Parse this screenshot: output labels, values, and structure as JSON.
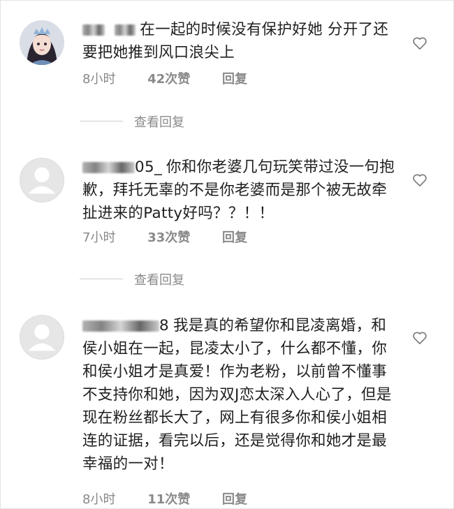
{
  "comments": [
    {
      "username_visible": "",
      "text": "在一起的时候没有保护好她 分开了还要把她推到风口浪尖上",
      "time": "8小时",
      "likes": "42次赞",
      "reply": "回复"
    },
    {
      "username_visible": "05_",
      "text": "你和你老婆几句玩笑带过没一句抱歉，拜托无辜的不是你老婆而是那个被无故牵扯进来的Patty好吗？？！！",
      "time": "7小时",
      "likes": "33次赞",
      "reply": "回复"
    },
    {
      "username_visible": "8",
      "text": "我是真的希望你和昆凌离婚，和侯小姐在一起，昆凌太小了，什么都不懂，你和侯小姐才是真爱！作为老粉，以前曾不懂事不支持你和她，因为双J恋太深入人心了，但是现在粉丝都长大了，网上有很多你和侯小姐相连的证据，看完以后，还是觉得你和她才是最幸福的一对！",
      "time": "8小时",
      "likes": "11次赞",
      "reply": "回复"
    }
  ],
  "view_replies": [
    "查看回复",
    "查看回复"
  ],
  "icons": {
    "like": "heart-outline-icon",
    "avatar_default": "default-avatar-icon"
  }
}
